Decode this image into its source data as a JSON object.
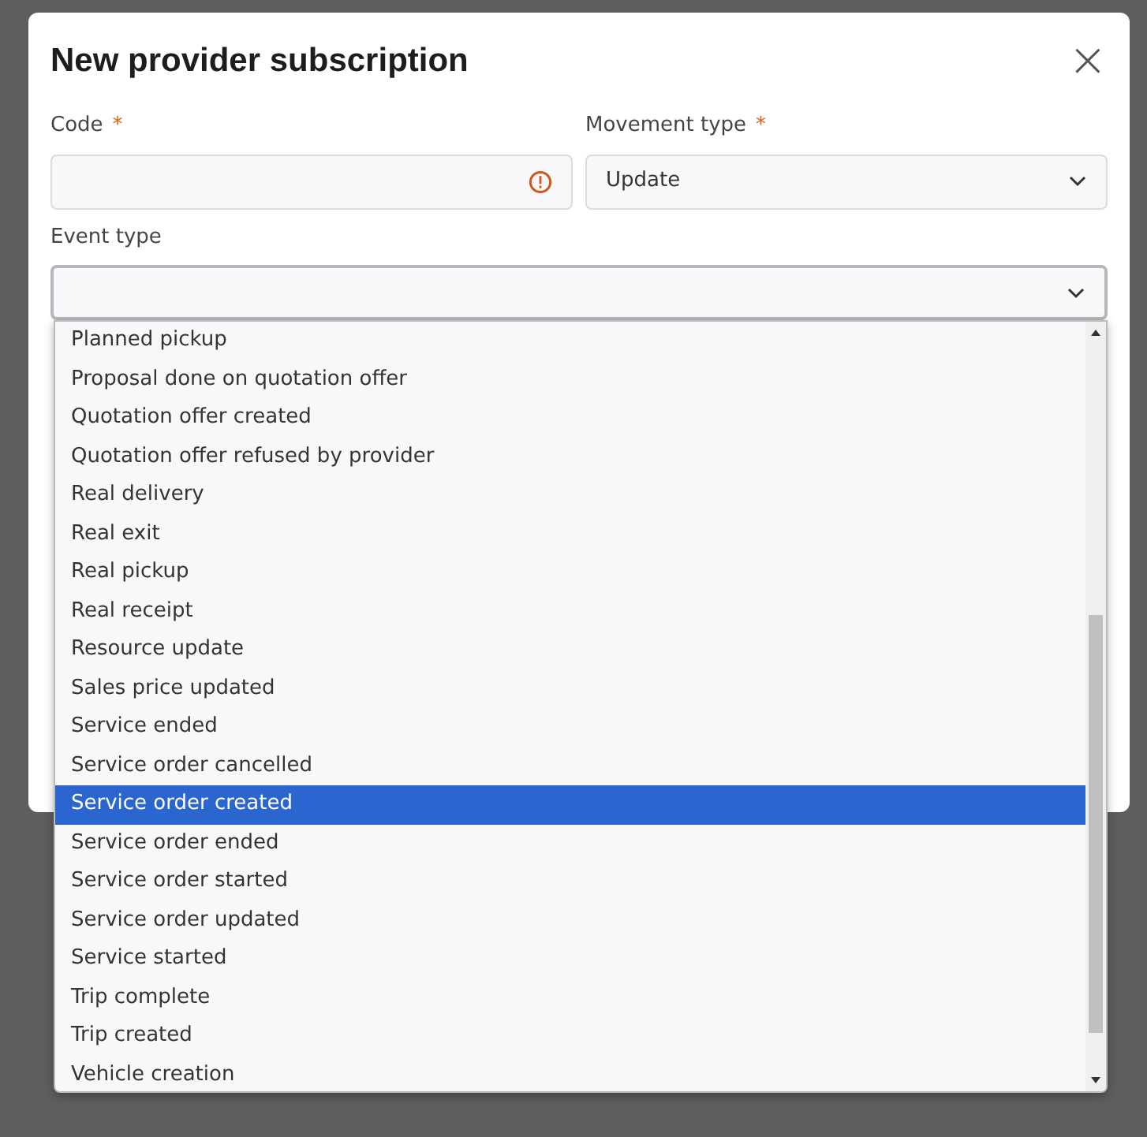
{
  "dialog": {
    "title": "New provider subscription",
    "close": "×"
  },
  "fields": [
    {
      "label": "Code",
      "required_mark": "*",
      "error": true,
      "kind": "text"
    },
    {
      "label": "Movement type",
      "required_mark": "*",
      "value": "Update",
      "error": false,
      "kind": "select"
    }
  ],
  "event_type": {
    "label": "Event type",
    "expanded": true,
    "options": [
      {
        "label": "Planned pickup",
        "selected": false
      },
      {
        "label": "Proposal done on quotation offer",
        "selected": false
      },
      {
        "label": "Quotation offer created",
        "selected": false
      },
      {
        "label": "Quotation offer refused by provider",
        "selected": false
      },
      {
        "label": "Real delivery",
        "selected": false
      },
      {
        "label": "Real exit",
        "selected": false
      },
      {
        "label": "Real pickup",
        "selected": false
      },
      {
        "label": "Real receipt",
        "selected": false
      },
      {
        "label": "Resource update",
        "selected": false
      },
      {
        "label": "Sales price updated",
        "selected": false
      },
      {
        "label": "Service ended",
        "selected": false
      },
      {
        "label": "Service order cancelled",
        "selected": false
      },
      {
        "label": "Service order created",
        "selected": true
      },
      {
        "label": "Service order ended",
        "selected": false
      },
      {
        "label": "Service order started",
        "selected": false
      },
      {
        "label": "Service order updated",
        "selected": false
      },
      {
        "label": "Service started",
        "selected": false
      },
      {
        "label": "Trip complete",
        "selected": false
      },
      {
        "label": "Trip created",
        "selected": false
      },
      {
        "label": "Vehicle creation",
        "selected": false
      }
    ]
  }
}
